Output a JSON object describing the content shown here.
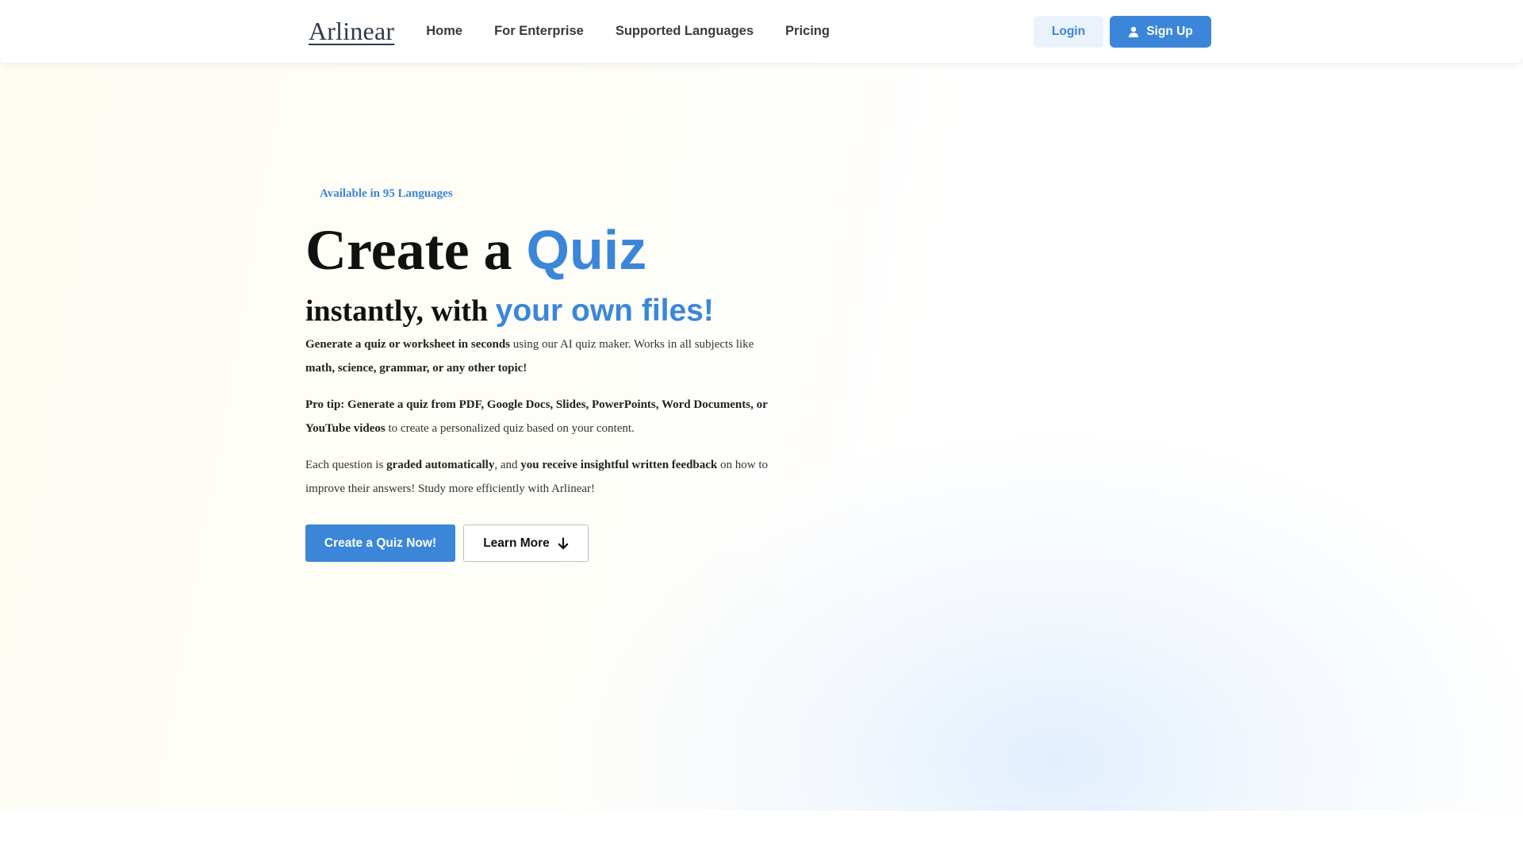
{
  "brand": {
    "logo_text": "Arlinear"
  },
  "nav": {
    "links": [
      "Home",
      "For Enterprise",
      "Supported Languages",
      "Pricing"
    ],
    "login_label": "Login",
    "signup_label": "Sign Up",
    "signup_icon": "user-icon"
  },
  "hero": {
    "badge": "Available in 95 Languages",
    "headline_1_dark": "Create a ",
    "headline_1_blue": "Quiz",
    "headline_2_dark": "instantly, with ",
    "headline_2_blue": "your own files!",
    "p1_bold_1": "Generate a quiz or worksheet in seconds",
    "p1_text_1": " using our AI quiz maker. Works in all subjects like ",
    "p1_bold_2": "math, science, grammar, or any other topic!",
    "p2_bold": "Pro tip: Generate a quiz from PDF, Google Docs, Slides, PowerPoints, Word Documents, or YouTube videos",
    "p2_text": " to create a personalized quiz based on your content.",
    "p3_text_1": "Each question is ",
    "p3_bold_1": "graded automatically",
    "p3_text_2": ", and ",
    "p3_bold_2": "you receive insightful written feedback",
    "p3_text_3": " on how to improve their answers! Study more efficiently with Arlinear!",
    "cta_primary": "Create a Quiz Now!",
    "cta_secondary": "Learn More",
    "cta_secondary_icon": "arrow-down-icon"
  },
  "colors": {
    "accent": "#3b86d9",
    "login_bg": "#eaf2fb",
    "heading": "#111111"
  }
}
